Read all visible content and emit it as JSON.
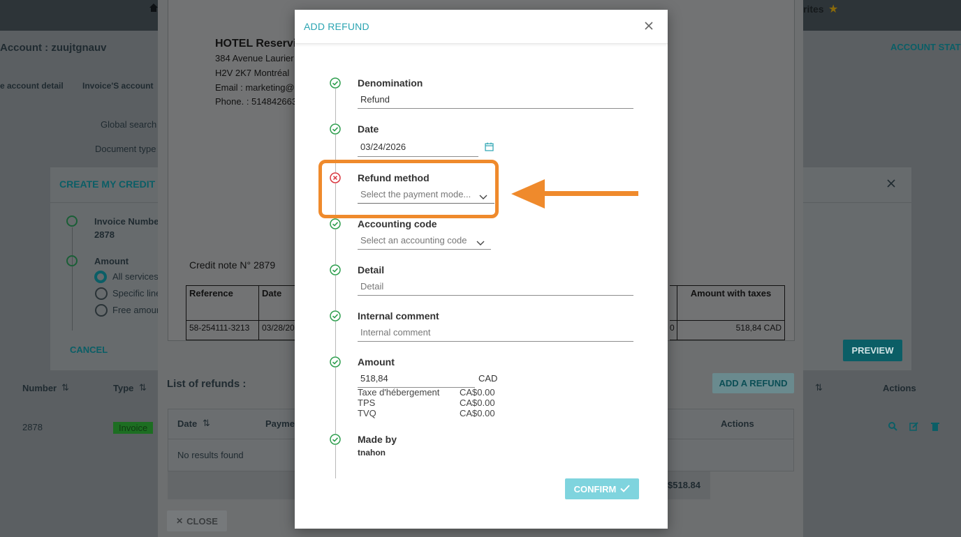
{
  "background": {
    "account_title": "Account : zuujtgnauv",
    "account_statement": "ACCOUNT STATE",
    "favorites": "rites",
    "tab_account_detail": "e account detail",
    "tab_invoice_account": "Invoice'S account",
    "global_search": "Global search",
    "document_type": "Document type",
    "table_headers": {
      "number": "Number",
      "type": "Type",
      "actions": "Actions"
    },
    "row": {
      "number": "2878",
      "type": "Invoice"
    }
  },
  "credit_modal": {
    "title": "CREATE MY CREDIT NO",
    "invoice_number_label": "Invoice Numbe",
    "invoice_number_value": "2878",
    "amount_label": "Amount",
    "options": [
      "All services",
      "Specific line",
      "Free amour"
    ],
    "cancel": "CANCEL",
    "preview": "PREVIEW"
  },
  "document": {
    "hotel_name": "HOTEL Reservi",
    "address1": "384 Avenue Laurier",
    "address2": "H2V 2K7 Montréal",
    "email": "Email : marketing@",
    "phone": "Phone. : 514842663",
    "credit_note": "Credit note N° 2879",
    "table": {
      "col_reference": "Reference",
      "col_date": "Date",
      "col_amount": "Amount with taxes",
      "reference": "58-254111-3213",
      "date": "03/28/202",
      "mid": "0",
      "amount": "518,84 CAD"
    }
  },
  "refund_list": {
    "title": "List of refunds :",
    "add_button": "ADD A REFUND",
    "col_date": "Date",
    "col_payment": "Payme",
    "col_actions": "Actions",
    "empty": "No results found",
    "total": "$518.84",
    "close": "CLOSE"
  },
  "refund_modal": {
    "title": "ADD REFUND",
    "denomination": {
      "label": "Denomination",
      "value": "Refund"
    },
    "date": {
      "label": "Date",
      "value": "03/24/2026"
    },
    "refund_method": {
      "label": "Refund method",
      "placeholder": "Select the payment mode..."
    },
    "accounting_code": {
      "label": "Accounting code",
      "placeholder": "Select an accounting code"
    },
    "detail": {
      "label": "Detail",
      "placeholder": "Detail"
    },
    "internal_comment": {
      "label": "Internal comment",
      "placeholder": "Internal comment"
    },
    "amount": {
      "label": "Amount",
      "value": "518,84",
      "currency": "CAD",
      "taxes": [
        {
          "name": "Taxe d'hébergement",
          "value": "CA$0.00"
        },
        {
          "name": "TPS",
          "value": "CA$0.00"
        },
        {
          "name": "TVQ",
          "value": "CA$0.00"
        }
      ]
    },
    "made_by": {
      "label": "Made by",
      "value": "tnahon"
    },
    "confirm": "CONFIRM"
  },
  "colors": {
    "accent": "#2aa4b2",
    "success": "#2e9e4e",
    "error": "#d9363e",
    "annotation": "#ef8a2c"
  }
}
